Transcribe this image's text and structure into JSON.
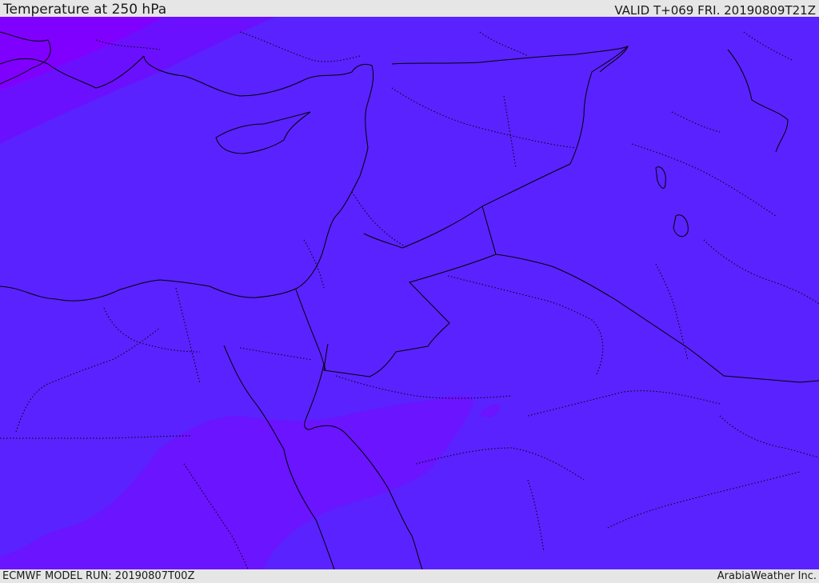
{
  "header": {
    "title": "Temperature at 250 hPa",
    "valid": "VALID T+069 FRI. 20190809T21Z"
  },
  "footer": {
    "model_run": "ECMWF MODEL RUN: 20190807T00Z",
    "credit": "ArabiaWeather Inc."
  },
  "colors": {
    "background_field": "#5a22ff",
    "cool_band_northwest": "#6a10ff",
    "coolest_band_northwest": "#8000ff",
    "cool_band_south": "#6a14ff",
    "border_lines": "#000000"
  }
}
